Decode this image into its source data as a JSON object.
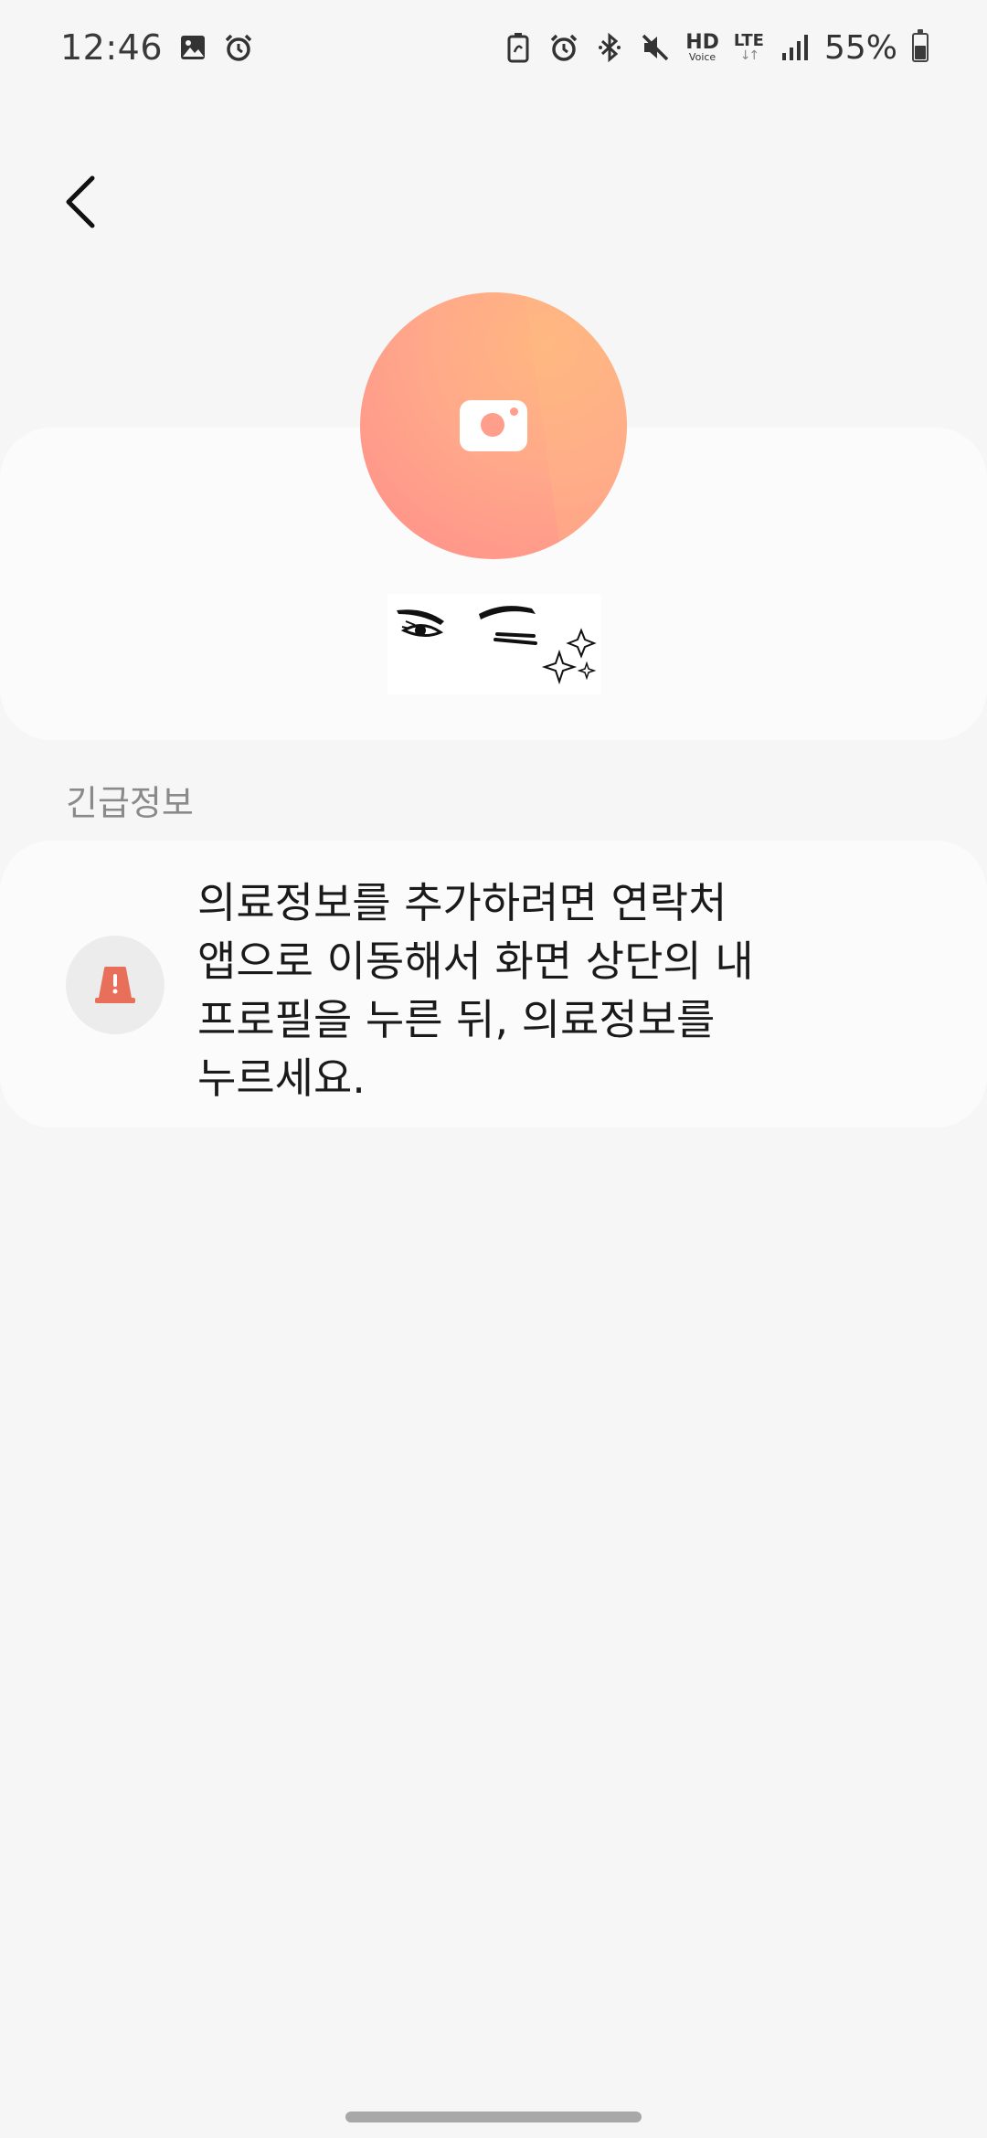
{
  "status_bar": {
    "time": "12:46",
    "hd_label": "HD",
    "hd_sub_label": "Voice",
    "lte_label": "LTE",
    "lte_arrows": "↓↑",
    "battery_percent": "55%",
    "battery_level": 0.55,
    "left_icons": [
      "image-icon",
      "alarm-icon"
    ],
    "right_icons": [
      "battery-saver-icon",
      "alarm-icon",
      "bluetooth-icon",
      "mute-icon",
      "hd-voice-icon",
      "lte-icon",
      "signal-icon",
      "battery-icon"
    ]
  },
  "header": {
    "back_icon": "chevron-left-icon"
  },
  "profile": {
    "avatar_icon": "camera-icon",
    "avatar_colors": [
      "#ffb680",
      "#ff8e8a"
    ]
  },
  "emergency": {
    "section_title": "긴급정보",
    "alert_icon": "alert-cone-icon",
    "alert_color": "#e8705a",
    "message": "의료정보를 추가하려면 연락처 앱으로 이동해서 화면 상단의 내 프로필을 누른 뒤, 의료정보를 누르세요."
  }
}
